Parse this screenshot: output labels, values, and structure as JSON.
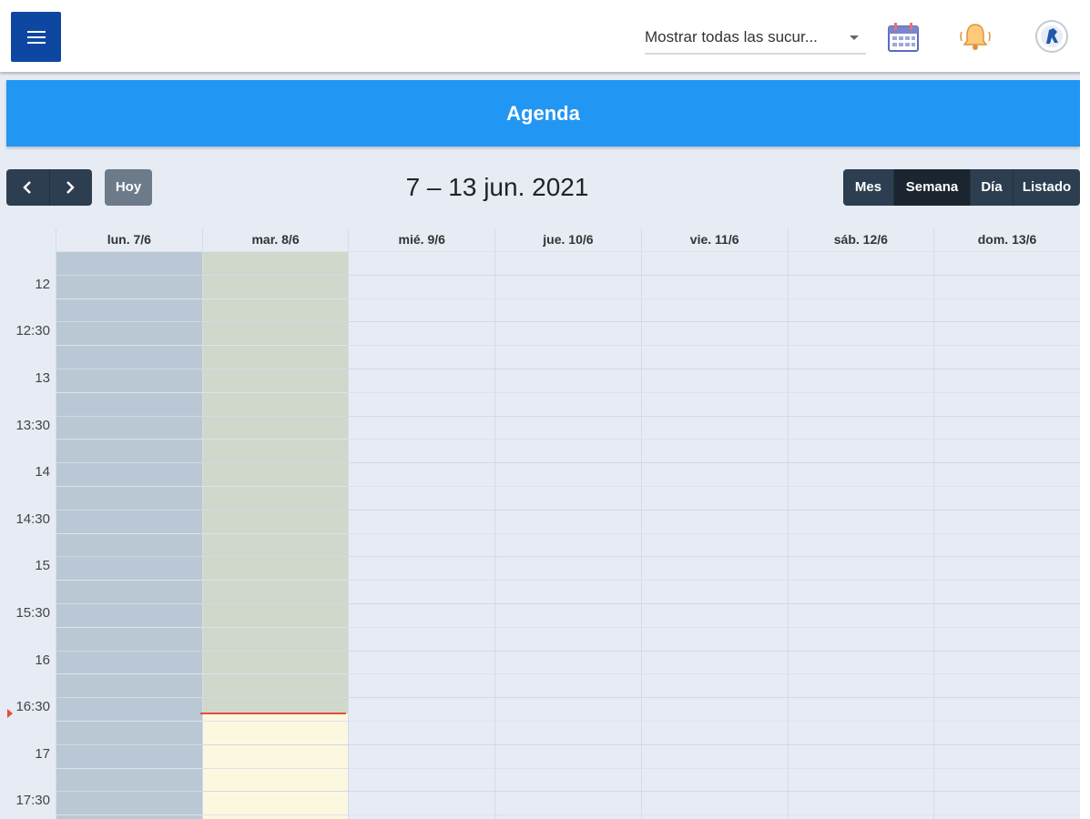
{
  "topbar": {
    "menu_icon": "hamburger-menu-icon",
    "branch_select": {
      "value": "Mostrar todas las sucur..."
    },
    "icons": [
      "calendar-icon",
      "bell-icon",
      "user-avatar-icon"
    ]
  },
  "header": {
    "title": "Agenda"
  },
  "toolbar": {
    "prev_icon": "chevron-left-icon",
    "next_icon": "chevron-right-icon",
    "today_label": "Hoy",
    "range_title": "7 – 13 jun. 2021",
    "views": [
      {
        "label": "Mes",
        "active": false
      },
      {
        "label": "Semana",
        "active": true
      },
      {
        "label": "Día",
        "active": false
      },
      {
        "label": "Listado",
        "active": false
      }
    ]
  },
  "calendar": {
    "days": [
      "lun. 7/6",
      "mar. 8/6",
      "mié. 9/6",
      "jue. 10/6",
      "vie. 11/6",
      "sáb. 12/6",
      "dom. 13/6"
    ],
    "times": [
      "12",
      "12:30",
      "13",
      "13:30",
      "14",
      "14:30",
      "15",
      "15:30",
      "16",
      "16:30",
      "17",
      "17:30"
    ]
  },
  "colors": {
    "primary": "#0d47a1",
    "header_band": "#2196f3",
    "toolbar_dark": "#2c3e50",
    "today_button": "#6c7a89",
    "now_indicator": "#e74c3c",
    "past_day": "#bac8d5",
    "today_past": "#d0d8cc",
    "today_future": "#fcf8e0"
  }
}
